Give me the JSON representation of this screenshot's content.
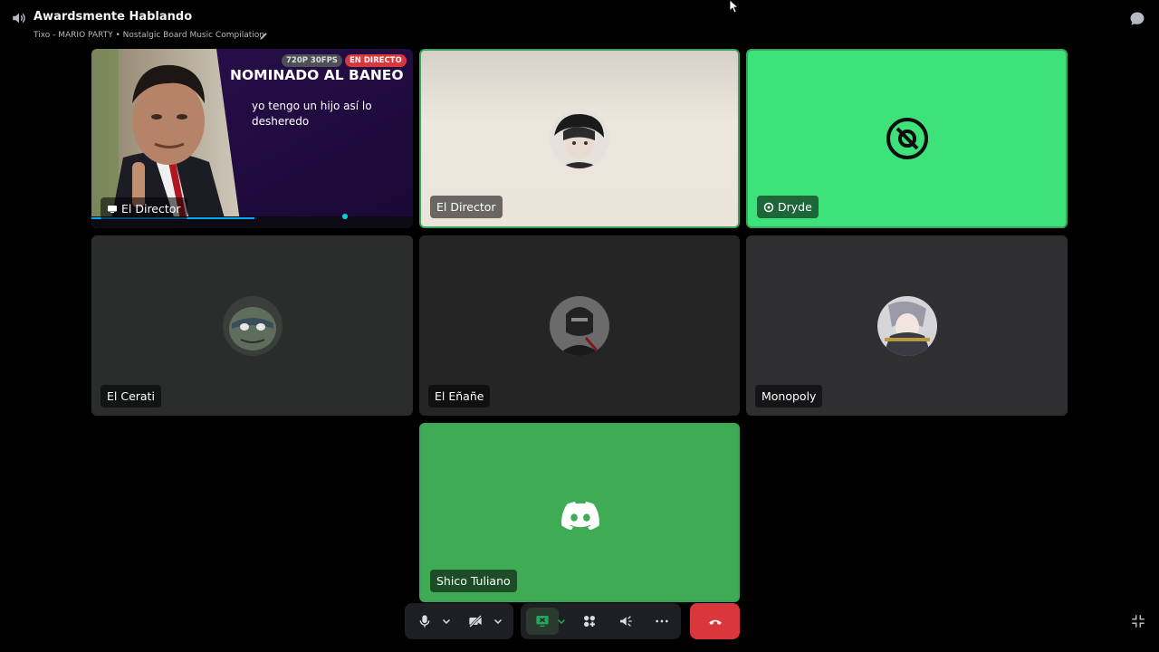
{
  "header": {
    "channel_name": "Awardsmente Hablando",
    "status": "Tixo - MARIO PARTY • Nostalgic Board Music Compilation"
  },
  "stream_tile": {
    "title": "NOMINADO AL BANEO",
    "subtitle": "yo tengo un hijo así lo desheredo",
    "quality_badge": "720P 30FPS",
    "live_badge": "EN DIRECTO",
    "name": "El Director"
  },
  "tiles": [
    {
      "name": "El Director",
      "speaking": true
    },
    {
      "name": "Dryde",
      "speaking": true
    },
    {
      "name": "El Cerati",
      "speaking": false
    },
    {
      "name": "El Eñañe",
      "speaking": false
    },
    {
      "name": "Monopoly",
      "speaking": false
    },
    {
      "name": "Shico Tuliano",
      "speaking": true
    }
  ],
  "icons": {
    "speaker": "speaker-icon",
    "pencil": "pencil-icon",
    "chat": "chat-icon",
    "mic": "microphone-icon",
    "camera_off": "camera-off-icon",
    "screen_share": "screen-share-icon",
    "activities": "activities-icon",
    "soundboard": "soundboard-icon",
    "more": "more-icon",
    "hangup": "hangup-icon",
    "collapse": "collapse-icon"
  },
  "colors": {
    "speaking_border": "#3ba55d",
    "hangup": "#da373c",
    "dryde_bg": "#3ee27b",
    "shico_bg": "#3fab54"
  }
}
